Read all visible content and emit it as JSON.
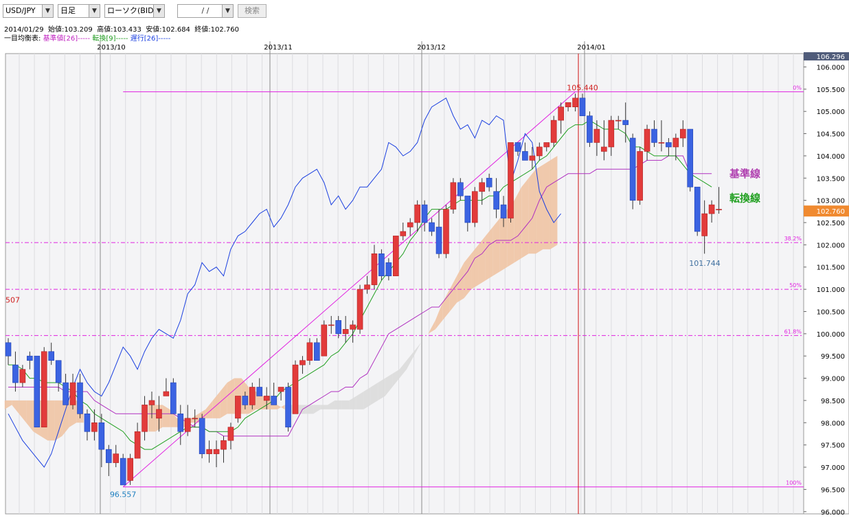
{
  "toolbar": {
    "symbol": "USD/JPY",
    "timeframe": "日足",
    "chart_type": "ローソク(BID)",
    "date_placeholder": "/ /",
    "search_label": "検索"
  },
  "ohlc_line": {
    "date": "2014/01/29",
    "open_label": "始値:",
    "open": "103.209",
    "high_label": "高値:",
    "high": "103.433",
    "low_label": "安値:",
    "low": "102.684",
    "close_label": "終値:",
    "close": "102.760"
  },
  "indicator_legend": {
    "title": "一目均衡表:",
    "kijun": "基準値[26]-----",
    "tenkan": "転換[9]-----",
    "chikou": "遅行[26]-----"
  },
  "colors": {
    "up": "#e23b3b",
    "down": "#3b63e2",
    "kijun": "#b030c0",
    "tenkan": "#22a022",
    "chikou": "#1a3fe0",
    "fib": "#e020e0",
    "cloud_up": "#f0c4a4",
    "cloud_down": "#dcdcdc",
    "current_price_bg": "#f08a30"
  },
  "chart_data": {
    "type": "candlestick",
    "y_ticks": [
      "106.000",
      "105.500",
      "105.000",
      "104.500",
      "104.000",
      "103.500",
      "103.000",
      "102.500",
      "102.000",
      "101.500",
      "101.000",
      "100.500",
      "100.000",
      "99.500",
      "99.000",
      "98.500",
      "98.000",
      "97.500",
      "97.000",
      "96.500",
      "96.000"
    ],
    "y_top_label": "106.296",
    "ylim": [
      95.95,
      106.3
    ],
    "months": [
      "2013/10",
      "2013/11",
      "2013/12",
      "2014/01"
    ],
    "current_price": "102.760",
    "high_annotation": "105.440",
    "low_annotation": "96.557",
    "recent_low_annotation": "101.744",
    "left_edge_label": "507",
    "fib_levels": [
      {
        "label": "0%",
        "value": 105.44
      },
      {
        "label": "38.2%",
        "value": 102.05
      },
      {
        "label": "50%",
        "value": 101.0
      },
      {
        "label": "61.8%",
        "value": 99.96
      },
      {
        "label": "100%",
        "value": 96.557
      }
    ],
    "kijun_label": "基準線",
    "tenkan_label": "転換線",
    "candles": [
      [
        99.8,
        99.9,
        99.3,
        99.5
      ],
      [
        99.3,
        99.6,
        98.7,
        98.9
      ],
      [
        98.9,
        99.3,
        98.8,
        99.2
      ],
      [
        99.5,
        99.6,
        99.2,
        99.4
      ],
      [
        99.5,
        99.5,
        97.9,
        97.9
      ],
      [
        97.9,
        99.7,
        97.9,
        99.6
      ],
      [
        99.6,
        99.8,
        99.3,
        99.4
      ],
      [
        99.4,
        99.4,
        98.7,
        98.9
      ],
      [
        98.9,
        99.1,
        98.4,
        98.4
      ],
      [
        98.4,
        99.1,
        98.3,
        98.9
      ],
      [
        98.9,
        99.1,
        98.1,
        98.2
      ],
      [
        98.2,
        98.3,
        97.6,
        97.8
      ],
      [
        97.8,
        98.3,
        97.6,
        98.0
      ],
      [
        98.0,
        98.2,
        97.0,
        97.4
      ],
      [
        97.4,
        97.5,
        96.8,
        97.1
      ],
      [
        97.1,
        97.5,
        97.0,
        97.3
      ],
      [
        97.2,
        97.3,
        96.6,
        96.6
      ],
      [
        96.7,
        97.3,
        96.6,
        97.2
      ],
      [
        97.2,
        98.0,
        97.2,
        97.8
      ],
      [
        97.8,
        98.6,
        97.6,
        98.4
      ],
      [
        98.4,
        98.7,
        98.1,
        98.5
      ],
      [
        98.1,
        98.6,
        97.8,
        98.3
      ],
      [
        98.6,
        99.0,
        98.6,
        98.7
      ],
      [
        98.9,
        99.0,
        98.2,
        98.2
      ],
      [
        98.2,
        98.4,
        97.5,
        97.8
      ],
      [
        97.8,
        98.4,
        97.7,
        98.1
      ],
      [
        98.1,
        98.3,
        97.9,
        98.1
      ],
      [
        98.1,
        98.2,
        97.2,
        97.3
      ],
      [
        97.3,
        97.6,
        97.1,
        97.4
      ],
      [
        97.3,
        97.6,
        97.0,
        97.4
      ],
      [
        97.4,
        97.7,
        97.1,
        97.6
      ],
      [
        97.6,
        98.0,
        97.4,
        97.9
      ],
      [
        98.1,
        98.6,
        98.0,
        98.6
      ],
      [
        98.6,
        98.7,
        98.3,
        98.4
      ],
      [
        98.4,
        98.9,
        98.3,
        98.8
      ],
      [
        98.8,
        99.0,
        98.6,
        98.6
      ],
      [
        98.5,
        98.8,
        98.3,
        98.6
      ],
      [
        98.6,
        98.9,
        98.4,
        98.4
      ],
      [
        98.7,
        98.8,
        98.5,
        98.8
      ],
      [
        98.8,
        98.9,
        97.8,
        97.9
      ],
      [
        98.2,
        99.4,
        98.2,
        99.3
      ],
      [
        99.3,
        99.5,
        99.1,
        99.4
      ],
      [
        99.4,
        99.9,
        99.3,
        99.8
      ],
      [
        99.8,
        99.9,
        99.4,
        99.4
      ],
      [
        99.5,
        100.3,
        99.5,
        100.2
      ],
      [
        100.2,
        100.4,
        100.0,
        100.2
      ],
      [
        100.3,
        100.4,
        99.9,
        100.0
      ],
      [
        100.0,
        100.4,
        99.8,
        100.1
      ],
      [
        100.1,
        100.3,
        99.8,
        100.2
      ],
      [
        100.1,
        101.1,
        100.0,
        101.0
      ],
      [
        101.0,
        101.3,
        100.9,
        101.1
      ],
      [
        101.1,
        102.0,
        101.0,
        101.8
      ],
      [
        101.8,
        101.9,
        101.2,
        101.3
      ],
      [
        101.6,
        101.7,
        101.2,
        101.3
      ],
      [
        101.3,
        102.2,
        101.3,
        102.2
      ],
      [
        102.2,
        102.5,
        102.1,
        102.3
      ],
      [
        102.4,
        102.6,
        102.2,
        102.5
      ],
      [
        102.5,
        103.0,
        102.3,
        102.9
      ],
      [
        102.9,
        103.0,
        102.3,
        102.5
      ],
      [
        102.5,
        102.6,
        102.2,
        102.3
      ],
      [
        102.4,
        102.8,
        101.7,
        101.8
      ],
      [
        101.8,
        102.9,
        101.7,
        102.8
      ],
      [
        102.8,
        103.5,
        102.7,
        103.4
      ],
      [
        103.4,
        103.5,
        103.0,
        103.1
      ],
      [
        103.1,
        103.1,
        102.3,
        102.5
      ],
      [
        102.5,
        103.3,
        102.4,
        103.2
      ],
      [
        103.2,
        103.5,
        102.9,
        103.4
      ],
      [
        103.5,
        103.6,
        103.2,
        103.3
      ],
      [
        103.2,
        103.5,
        102.6,
        102.8
      ],
      [
        102.9,
        103.1,
        102.4,
        102.6
      ],
      [
        102.6,
        104.3,
        102.5,
        104.3
      ],
      [
        104.3,
        104.3,
        104.0,
        104.1
      ],
      [
        104.1,
        104.3,
        103.9,
        103.9
      ],
      [
        103.9,
        104.2,
        103.7,
        104.0
      ],
      [
        104.0,
        104.3,
        103.9,
        104.2
      ],
      [
        104.2,
        104.3,
        104.1,
        104.3
      ],
      [
        104.3,
        104.9,
        104.2,
        104.8
      ],
      [
        104.8,
        105.2,
        104.5,
        105.1
      ],
      [
        105.1,
        105.2,
        105.0,
        105.2
      ],
      [
        105.1,
        105.4,
        105.0,
        105.3
      ],
      [
        105.3,
        105.4,
        104.9,
        104.9
      ],
      [
        104.9,
        105.0,
        104.2,
        104.3
      ],
      [
        104.3,
        104.8,
        104.0,
        104.6
      ],
      [
        104.1,
        104.8,
        103.9,
        104.2
      ],
      [
        104.2,
        104.9,
        104.0,
        104.8
      ],
      [
        104.8,
        104.9,
        104.6,
        104.8
      ],
      [
        104.8,
        105.2,
        104.3,
        104.7
      ],
      [
        104.4,
        104.5,
        102.8,
        103.0
      ],
      [
        103.0,
        104.2,
        102.9,
        104.1
      ],
      [
        104.1,
        104.7,
        103.9,
        104.6
      ],
      [
        104.6,
        104.8,
        104.2,
        104.3
      ],
      [
        104.3,
        104.8,
        104.1,
        104.3
      ],
      [
        104.3,
        104.4,
        104.0,
        104.2
      ],
      [
        104.2,
        104.5,
        103.9,
        104.4
      ],
      [
        104.4,
        104.8,
        104.2,
        104.6
      ],
      [
        104.6,
        104.6,
        103.2,
        103.3
      ],
      [
        103.3,
        103.3,
        102.2,
        102.3
      ],
      [
        102.2,
        103.0,
        101.8,
        102.7
      ],
      [
        102.7,
        103.0,
        102.5,
        102.9
      ],
      [
        102.8,
        103.3,
        102.7,
        102.8
      ]
    ]
  }
}
